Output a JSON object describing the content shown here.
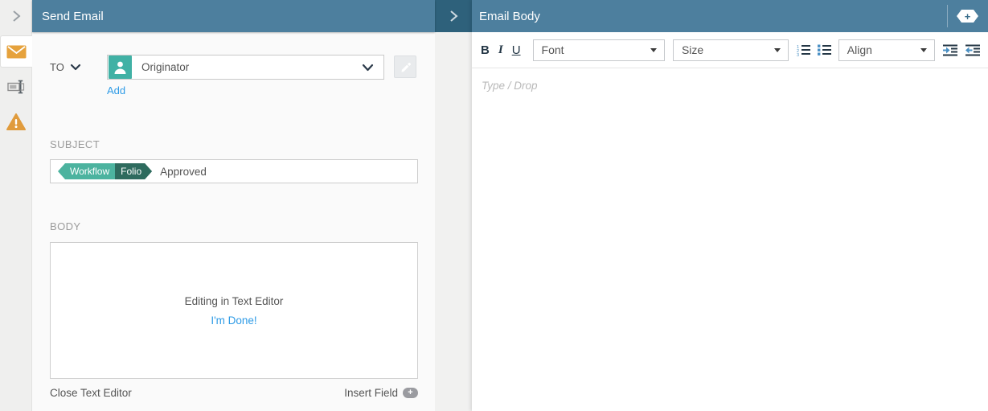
{
  "left_panel": {
    "title": "Send Email",
    "to_section": {
      "label": "TO",
      "selected_recipient": "Originator",
      "add_link": "Add"
    },
    "subject_section": {
      "label": "SUBJECT",
      "tag_left": "Workflow",
      "tag_right": "Folio",
      "text": "Approved"
    },
    "body_section": {
      "label": "BODY",
      "overlay_message": "Editing in Text Editor",
      "done_link": "I'm Done!",
      "close_link": "Close Text Editor",
      "insert_field_link": "Insert Field"
    }
  },
  "right_panel": {
    "title": "Email Body",
    "toolbar": {
      "bold_label": "B",
      "italic_label": "I",
      "underline_label": "U",
      "font_dropdown": "Font",
      "size_dropdown": "Size",
      "align_dropdown": "Align"
    },
    "editor_placeholder": "Type / Drop"
  },
  "icons": {
    "insert_field_plus": "+",
    "header_add_plus": "+"
  },
  "colors": {
    "header_teal": "#4d7f9e",
    "collapse_teal": "#2e617b",
    "accent_orange": "#e6a23c",
    "avatar_teal": "#41b1a5",
    "tag_teal": "#4cb39f",
    "tag_dark_teal": "#2e6b5e",
    "link_blue": "#2e9be6",
    "toolbar_icon": "#243746",
    "list_accent_blue": "#4a90c4"
  }
}
